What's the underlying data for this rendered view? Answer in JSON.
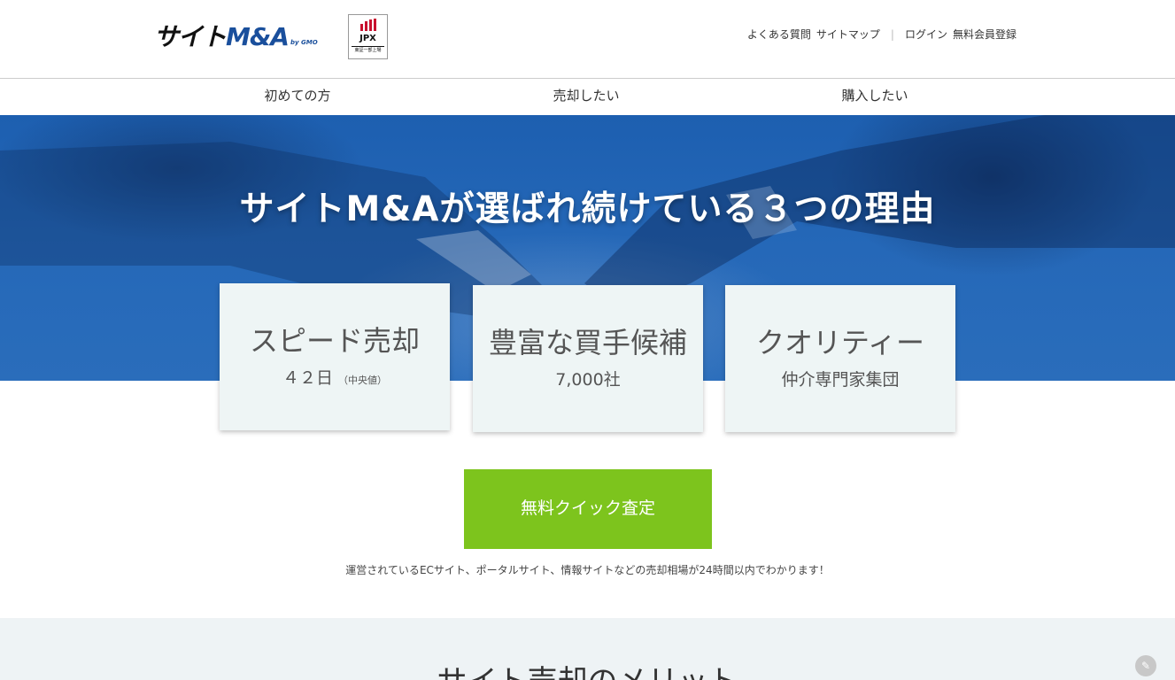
{
  "header": {
    "logo_main": "サイト",
    "logo_accent": "M&A",
    "logo_by": "by GMO",
    "jpx_label": "JPX",
    "jpx_foot": "東証一部上場",
    "links": {
      "faq": "よくある質問",
      "sitemap": "サイトマップ",
      "login": "ログイン",
      "register": "無料会員登録"
    }
  },
  "nav": {
    "items": [
      {
        "label": "初めての方"
      },
      {
        "label": "売却したい"
      },
      {
        "label": "購入したい"
      }
    ]
  },
  "hero": {
    "title": "サイトM&Aが選ばれ続けている３つの理由"
  },
  "cards": [
    {
      "title": "スピード売却",
      "sub": "４２日",
      "note": "（中央値）"
    },
    {
      "title": "豊富な買手候補",
      "sub": "7,000社"
    },
    {
      "title": "クオリティー",
      "sub": "仲介専門家集団"
    }
  ],
  "cta": {
    "label": "無料クイック査定",
    "note": "運営されているECサイト、ポータルサイト、情報サイトなどの売却相場が24時間以内でわかります！"
  },
  "lower": {
    "title": "サイト売却のメリット"
  },
  "colors": {
    "cta_green": "#7dc41d",
    "hero_blue": "#2568b8",
    "card_bg": "#eef5f5"
  },
  "icons": {
    "float": "pencil-icon"
  }
}
